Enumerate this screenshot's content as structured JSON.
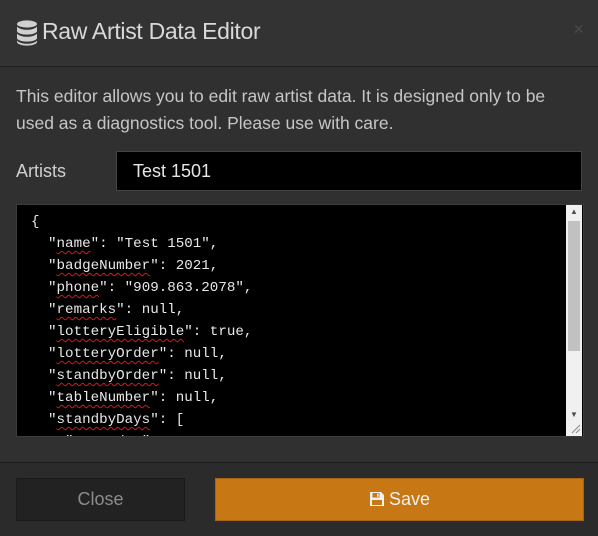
{
  "dialog": {
    "title": "Raw Artist Data Editor",
    "title_icon": "database-icon",
    "close_glyph": "×",
    "close_icon": "close-icon"
  },
  "description": "This editor allows you to edit raw artist data. It is designed only to be used as a diagnostics tool. Please use with care.",
  "artists_field": {
    "label": "Artists",
    "value": "Test 1501"
  },
  "editor": {
    "lines": [
      "{",
      "  \"name\": \"Test 1501\",",
      "  \"badgeNumber\": 2021,",
      "  \"phone\": \"909.863.2078\",",
      "  \"remarks\": null,",
      "  \"lotteryEligible\": true,",
      "  \"lotteryOrder\": null,",
      "  \"standbyOrder\": null,",
      "  \"tableNumber\": null,",
      "  \"standbyDays\": [",
      "    \"Saturday\","
    ]
  },
  "footer": {
    "close_label": "Close",
    "save_label": "Save",
    "save_icon": "floppy-disk-icon"
  },
  "colors": {
    "accent": "#c77713",
    "background": "#303030",
    "editor_background": "#000000"
  }
}
